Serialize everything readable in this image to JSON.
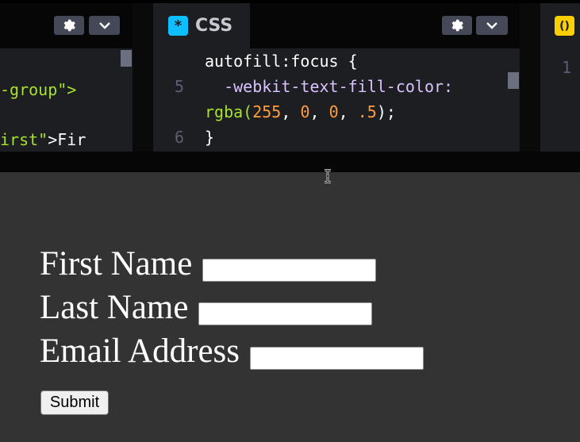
{
  "editor": {
    "html": {
      "lines": [
        {
          "pre": "-group\">",
          "cls": "c-str"
        },
        {
          "pre": "irst\"",
          "tail": ">Fir"
        }
      ],
      "settings_icon": "gear-icon",
      "collapse_icon": "chevron-down-icon"
    },
    "css": {
      "tab_label": "CSS",
      "badge": "*",
      "line1": "autofill:focus {",
      "ln5": "5",
      "line2": "  -webkit-text-fill-color:",
      "line3_fn": "rgba(",
      "line3_a": "255",
      "line3_sep1": ", ",
      "line3_b": "0",
      "line3_sep2": ", ",
      "line3_c": "0",
      "line3_sep3": ", ",
      "line3_d": ".5",
      "line3_end": ");",
      "ln6": "6",
      "line4": "}",
      "settings_icon": "gear-icon",
      "collapse_icon": "chevron-down-icon"
    },
    "js": {
      "badge": "()",
      "ln1": "1"
    }
  },
  "preview": {
    "first_name_label": "First Name",
    "last_name_label": "Last Name",
    "email_label": "Email Address",
    "first_name_value": "",
    "last_name_value": "",
    "email_value": "",
    "submit_label": "Submit"
  },
  "colors": {
    "css_badge": "#0ebeff",
    "js_badge": "#fcd000",
    "preview_bg": "#333333",
    "editor_bg": "#1d1e22"
  }
}
